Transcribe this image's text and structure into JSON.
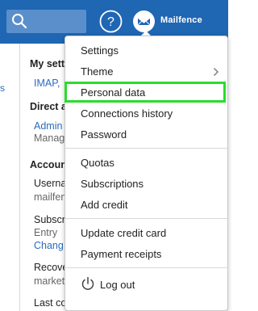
{
  "header": {
    "brand": "Mailfence",
    "icons": [
      "search-icon",
      "help-icon",
      "mailfence-logo-icon"
    ]
  },
  "background": {
    "left_item": "s",
    "rows": [
      {
        "text": "My setti",
        "style": "heading"
      },
      {
        "text": "IMAP, ",
        "style": "link"
      },
      {
        "text": "Direct a",
        "style": "heading"
      },
      {
        "text": "Admin",
        "style": "link"
      },
      {
        "text": "Manag",
        "style": "sub"
      },
      {
        "text": "Accoun",
        "style": "heading"
      },
      {
        "text": "Userna",
        "style": "label"
      },
      {
        "text": "mailfen",
        "style": "sub"
      },
      {
        "text": "Subscr",
        "style": "label"
      },
      {
        "text": "Entry",
        "style": "sub"
      },
      {
        "text": "Chang",
        "style": "link"
      },
      {
        "text": "Recove",
        "style": "label"
      },
      {
        "text": "market",
        "style": "sub"
      },
      {
        "text": "Last connection",
        "style": "label"
      }
    ]
  },
  "menu": {
    "settings": "Settings",
    "theme": "Theme",
    "personal_data": "Personal data",
    "connections_history": "Connections history",
    "password": "Password",
    "quotas": "Quotas",
    "subscriptions": "Subscriptions",
    "add_credit": "Add credit",
    "update_credit_card": "Update credit card",
    "payment_receipts": "Payment receipts",
    "log_out": "Log out"
  },
  "colors": {
    "header": "#1f66b3",
    "highlight": "#2bdc2b",
    "link": "#2a6cbf"
  }
}
